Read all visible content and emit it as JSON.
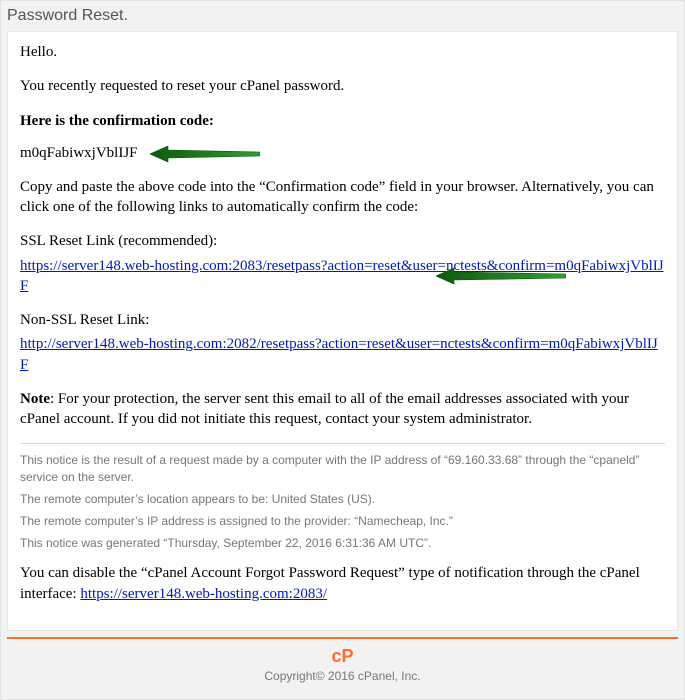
{
  "header": {
    "title": "Password Reset."
  },
  "body": {
    "greeting": "Hello.",
    "intro": "You recently requested to reset your cPanel password.",
    "code_heading": "Here is the confirmation code:",
    "confirmation_code": "m0qFabiwxjVblIJF",
    "instructions": "Copy and paste the above code into the “Confirmation code” field in your browser. Alternatively, you can click one of the following links to automatically confirm the code:",
    "ssl_label": "SSL Reset Link (recommended):",
    "ssl_link": "https://server148.web-hosting.com:2083/resetpass?action=reset&user=nctests&confirm=m0qFabiwxjVblIJF",
    "nonssl_label": "Non-SSL Reset Link:",
    "nonssl_link": "http://server148.web-hosting.com:2082/resetpass?action=reset&user=nctests&confirm=m0qFabiwxjVblIJF",
    "note_label": "Note",
    "note_text": ": For your protection, the server sent this email to all of the email addresses associated with your cPanel account. If you did not initiate this request, contact your system administrator.",
    "notice1": "This notice is the result of a request made by a computer with the IP address of “69.160.33.68” through the “cpaneld” service on the server.",
    "notice2": "The remote computer’s location appears to be: United States (US).",
    "notice3": "The remote computer’s IP address is assigned to the provider: “Namecheap, Inc.”",
    "notice4": "This notice was generated “Thursday, September 22, 2016 6:31:36 AM UTC”.",
    "disable_text_pre": "You can disable the “cPanel Account Forgot Password Request” type of notification through the cPanel interface: ",
    "disable_link": "https://server148.web-hosting.com:2083/"
  },
  "footer": {
    "logo_text": "cP",
    "copyright": "Copyright© 2016 cPanel, Inc."
  },
  "arrow_color": "#1b7a1b"
}
